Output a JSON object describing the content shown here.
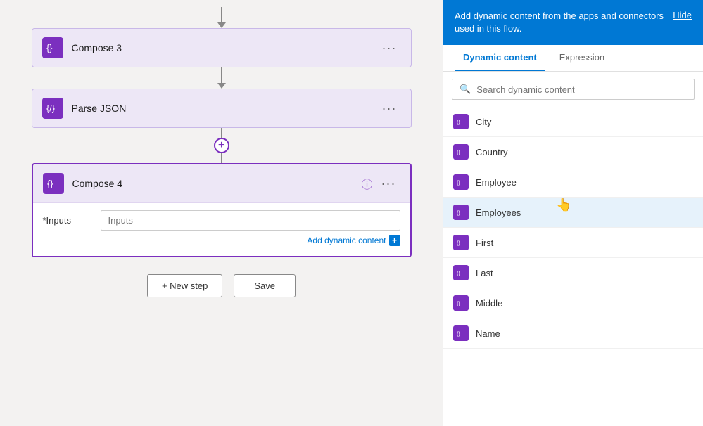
{
  "steps": [
    {
      "id": "compose3",
      "title": "Compose 3",
      "icon": "compose-icon"
    },
    {
      "id": "parse-json",
      "title": "Parse JSON",
      "icon": "parse-icon"
    },
    {
      "id": "compose4",
      "title": "Compose 4",
      "icon": "compose-icon"
    }
  ],
  "compose4": {
    "input_label": "*Inputs",
    "input_placeholder": "Inputs",
    "add_dynamic_text": "Add dynamic content"
  },
  "actions": {
    "new_step": "+ New step",
    "save": "Save"
  },
  "panel": {
    "header_text": "Add dynamic content from the apps and connectors used in this flow.",
    "hide_label": "Hide",
    "tabs": [
      "Dynamic content",
      "Expression"
    ],
    "active_tab": 0,
    "search_placeholder": "Search dynamic content",
    "items": [
      {
        "label": "City"
      },
      {
        "label": "Country"
      },
      {
        "label": "Employee"
      },
      {
        "label": "Employees",
        "selected": true
      },
      {
        "label": "First"
      },
      {
        "label": "Last"
      },
      {
        "label": "Middle"
      },
      {
        "label": "Name"
      }
    ]
  }
}
